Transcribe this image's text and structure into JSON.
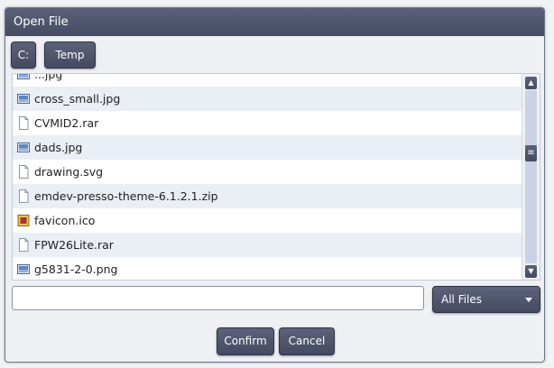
{
  "window": {
    "title": "Open File"
  },
  "path": {
    "items": [
      "C:",
      "Temp"
    ]
  },
  "files": [
    {
      "name": "...jpg",
      "type": "image"
    },
    {
      "name": "cross_small.jpg",
      "type": "image"
    },
    {
      "name": "CVMID2.rar",
      "type": "file"
    },
    {
      "name": "dads.jpg",
      "type": "image"
    },
    {
      "name": "drawing.svg",
      "type": "file"
    },
    {
      "name": "emdev-presso-theme-6.1.2.1.zip",
      "type": "file"
    },
    {
      "name": "favicon.ico",
      "type": "icon"
    },
    {
      "name": "FPW26Lite.rar",
      "type": "file"
    },
    {
      "name": "g5831-2-0.png",
      "type": "image"
    }
  ],
  "scrollbar": {
    "up_icon": "arrow-up-icon",
    "down_icon": "arrow-down-icon",
    "thumb_icon": "grip-icon",
    "position": 0.35
  },
  "filename": {
    "value": "",
    "placeholder": ""
  },
  "filter": {
    "selected": "All Files"
  },
  "buttons": {
    "confirm": "Confirm",
    "cancel": "Cancel"
  },
  "colors": {
    "accent": "#4f566d",
    "row_alt": "#eaeef5",
    "track": "#c8d3e6"
  }
}
